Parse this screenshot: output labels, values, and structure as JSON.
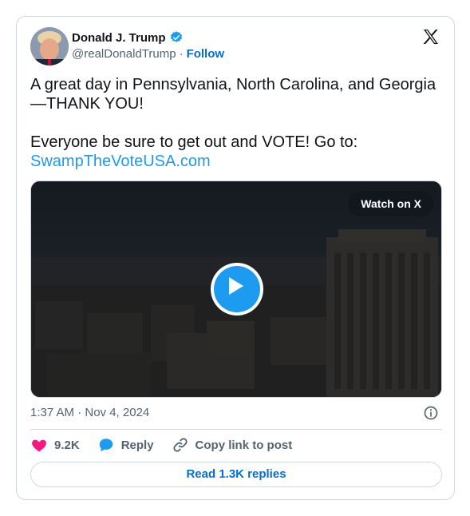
{
  "author": {
    "display_name": "Donald J. Trump",
    "handle": "@realDonaldTrump",
    "separator": "·",
    "follow_label": "Follow",
    "verified_color": "#1d9bf0"
  },
  "tweet": {
    "text": "A great day in Pennsylvania, North Carolina, and Georgia\n—THANK YOU!\n\nEveryone be sure to get out and VOTE!  Go to:",
    "link": "SwampTheVoteUSA.com"
  },
  "media": {
    "watch_label": "Watch on X",
    "type": "video"
  },
  "meta": {
    "timestamp": "1:37 AM · Nov 4, 2024"
  },
  "actions": {
    "like_count": "9.2K",
    "reply_label": "Reply",
    "copy_link_label": "Copy link to post"
  },
  "footer": {
    "read_replies_label": "Read 1.3K replies"
  },
  "colors": {
    "link": "#1d9bf0",
    "follow": "#006fd6",
    "like": "#f91880",
    "muted": "#536471",
    "border": "#cfd9de"
  },
  "icons": [
    "verified-badge-icon",
    "x-logo-icon",
    "play-icon",
    "info-icon",
    "heart-icon",
    "reply-icon",
    "link-icon"
  ]
}
